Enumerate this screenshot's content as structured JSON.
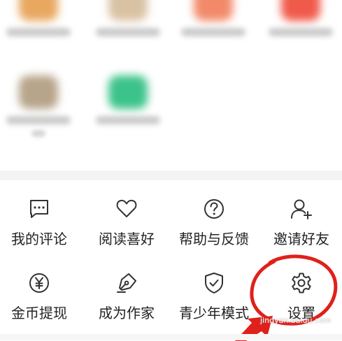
{
  "menu": {
    "row1": [
      {
        "label": "我的评论",
        "icon": "comment-icon"
      },
      {
        "label": "阅读喜好",
        "icon": "heart-icon"
      },
      {
        "label": "帮助与反馈",
        "icon": "help-icon"
      },
      {
        "label": "邀请好友",
        "icon": "add-user-icon"
      }
    ],
    "row2": [
      {
        "label": "金币提现",
        "icon": "coin-icon"
      },
      {
        "label": "成为作家",
        "icon": "pen-icon"
      },
      {
        "label": "青少年模式",
        "icon": "shield-icon"
      },
      {
        "label": "设置",
        "icon": "gear-icon"
      }
    ]
  },
  "watermark": "jingyan.baidu.com",
  "colors": {
    "annotation": "#e0201a",
    "icon_stroke": "#333333",
    "blur_orange": "#e8a860",
    "blur_tan": "#d9c2a3",
    "blur_coral": "#f28a6a",
    "blur_red": "#f05a4a",
    "blur_teal": "#3cc38a"
  }
}
